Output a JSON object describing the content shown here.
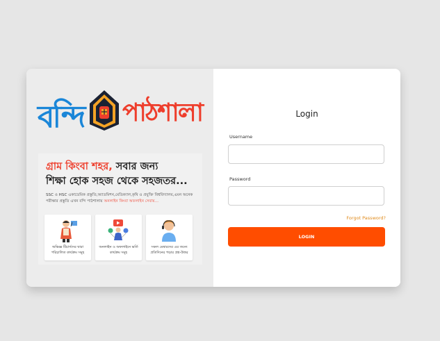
{
  "brand": {
    "word1": "বন্দি",
    "word2": "পাঠশালা",
    "colors": {
      "blue": "#1a86d8",
      "red": "#ee3e2c",
      "orange": "#ff4d00"
    }
  },
  "promo": {
    "headline_red": "গ্রাম কিংবা শহর,",
    "headline_dark1": " সবার জন্য",
    "headline_dark2": "শিক্ষা হোক সহজ থেকে সহজতর...",
    "desc_main": "SSC ও HSC একাডেমিক প্রস্তুতি,অ্যাডমিশন,মেডিক্যাল,কৃষি ও প্রযুক্তি বিশ্ববিদ্যালয়,এমন অনেক পরীক্ষার প্রস্তুতি এখন বন্দি পাঠশালায় ",
    "desc_link": "অনলাইন কিংবা অফলাইন সেবায়...",
    "features": [
      {
        "icon": "teacher-icon",
        "text": "অভিজ্ঞ টিচার্সদের দ্বারা পরিচালিত কার্যক্রম সমূহ"
      },
      {
        "icon": "online-learning-icon",
        "text": "অনলাইন ও অফলাইনে ভর্তি কার্যক্রম সমূহ"
      },
      {
        "icon": "support-agent-icon",
        "text": "সকল মেম্বারদের এর জন্যে প্রতিদিনের পড়ার প্রশ্ন-উত্তর"
      }
    ]
  },
  "form": {
    "title": "Login",
    "username_label": "Username",
    "username_value": "",
    "password_label": "Password",
    "password_value": "",
    "forgot": "Forgot Password?",
    "submit": "LOGIN"
  }
}
